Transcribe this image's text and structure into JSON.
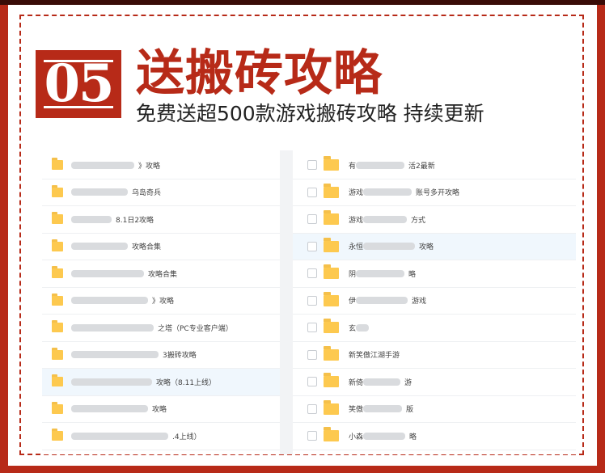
{
  "header": {
    "number": "05",
    "title": "送搬砖攻略",
    "subtitle": "免费送超500款游戏搬砖攻略 持续更新"
  },
  "left_list": [
    {
      "text": "》攻略",
      "blur": 78
    },
    {
      "text": "乌岛奇兵",
      "blur": 70
    },
    {
      "text": "8.1日2攻略",
      "blur": 50
    },
    {
      "text": "攻略合集",
      "blur": 70
    },
    {
      "text": "攻略合集",
      "blur": 90
    },
    {
      "text": "》攻略",
      "blur": 95
    },
    {
      "text": "之塔（PC专业客户端）",
      "blur": 102
    },
    {
      "text": "3搬砖攻略",
      "blur": 108
    },
    {
      "text": "攻略（8.11上线）",
      "blur": 100
    },
    {
      "text": "攻略",
      "blur": 95
    },
    {
      "text": ".4上线）",
      "blur": 120
    }
  ],
  "right_list": [
    {
      "pre": "有",
      "blur": 60,
      "post": "活2最新"
    },
    {
      "pre": "游戏",
      "blur": 60,
      "post": "账号多开攻略"
    },
    {
      "pre": "游戏",
      "blur": 54,
      "post": "方式"
    },
    {
      "pre": "永恒",
      "blur": 64,
      "post": "攻略"
    },
    {
      "pre": "阴",
      "blur": 60,
      "post": "略"
    },
    {
      "pre": "伊",
      "blur": 64,
      "post": "游戏"
    },
    {
      "pre": "玄",
      "blur": 16,
      "post": ""
    },
    {
      "pre": "新笑傲江湖手游",
      "blur": 0,
      "post": ""
    },
    {
      "pre": "新倚",
      "blur": 46,
      "post": "游"
    },
    {
      "pre": "笑傲",
      "blur": 48,
      "post": "版"
    },
    {
      "pre": "小森",
      "blur": 52,
      "post": "略"
    }
  ],
  "colors": {
    "accent": "#b72a18",
    "folder": "#fdc94f",
    "selected_row": "#f0f7fd"
  }
}
